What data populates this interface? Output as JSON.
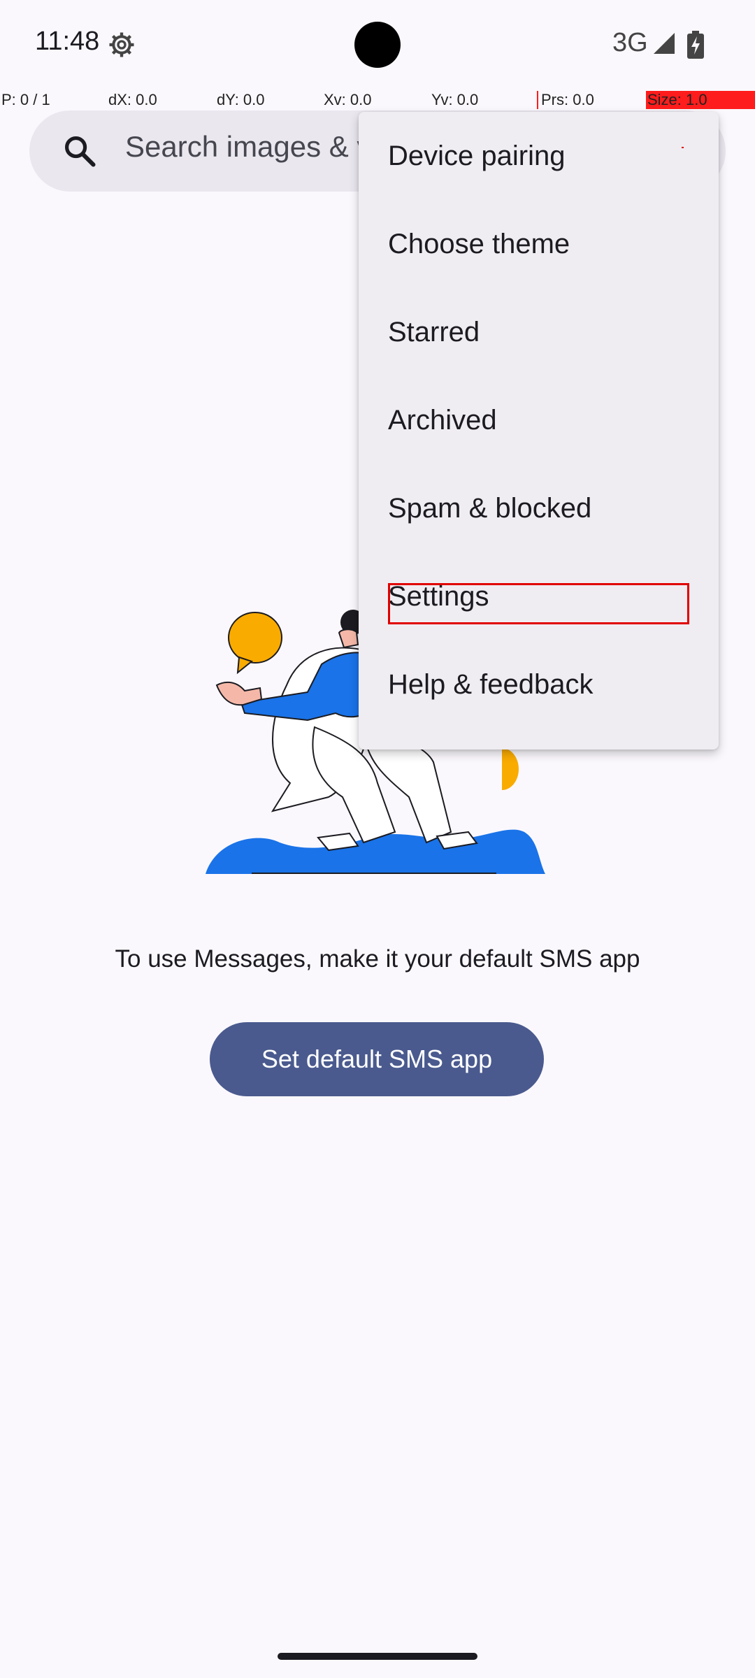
{
  "status_bar": {
    "time": "11:48",
    "network": "3G",
    "icons": [
      "settings-gear-icon",
      "cell-signal-icon",
      "battery-charging-icon"
    ]
  },
  "pointer_debug": {
    "p": "P: 0 / 1",
    "dx": "dX: 0.0",
    "dy": "dY: 0.0",
    "xv": "Xv: 0.0",
    "yv": "Yv: 0.0",
    "prs": "Prs: 0.0",
    "size": "Size: 1.0"
  },
  "search": {
    "placeholder": "Search images & v"
  },
  "menu": {
    "items": [
      {
        "label": "Device pairing"
      },
      {
        "label": "Choose theme"
      },
      {
        "label": "Starred"
      },
      {
        "label": "Archived"
      },
      {
        "label": "Spam & blocked"
      },
      {
        "label": "Settings"
      },
      {
        "label": "Help & feedback"
      }
    ],
    "highlighted": "Settings"
  },
  "main": {
    "info_text": "To use Messages, make it your default SMS app",
    "cta_label": "Set default SMS app"
  },
  "colors": {
    "background": "#fbf8fd",
    "menu_background": "#f0edf2",
    "search_background": "#eae7ef",
    "button": "#4a5a8e",
    "illustration_blue": "#1a73e8",
    "illustration_yellow": "#f9ab00",
    "highlight": "#e00000"
  }
}
